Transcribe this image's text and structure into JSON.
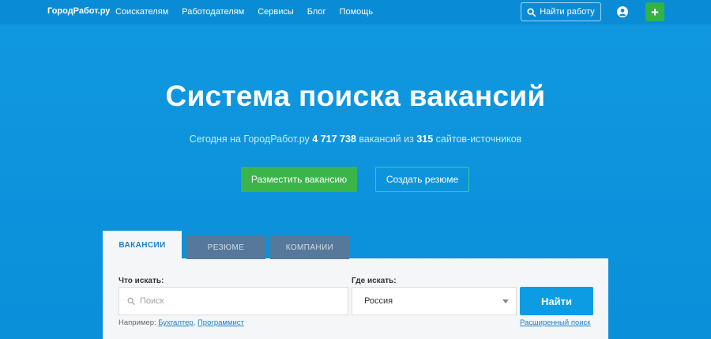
{
  "header": {
    "logo": "ГородРабот.ру",
    "nav": [
      "Соискателям",
      "Работодателям",
      "Сервисы",
      "Блог",
      "Помощь"
    ],
    "find_job_label": "Найти работу",
    "plus_label": "+"
  },
  "hero": {
    "title": "Система поиска вакансий",
    "sub_prefix": "Сегодня на ГородРабот.ру",
    "vacancy_count": "4 717 738",
    "sub_middle": "вакансий из",
    "source_count": "315",
    "sub_suffix": "сайтов-источников",
    "post_button": "Разместить вакансию",
    "resume_button": "Создать резюме"
  },
  "search": {
    "tabs": [
      "ВАКАНСИИ",
      "РЕЗЮМЕ",
      "КОМПАНИИ"
    ],
    "what_label": "Что искать:",
    "what_placeholder": "Поиск",
    "where_label": "Где искать:",
    "where_value": "Россия",
    "submit_label": "Найти",
    "example_prefix": "Например:",
    "example_1": "Бухгалтер",
    "example_sep": ",",
    "example_2": "Программист",
    "advanced_link": "Расширенный поиск"
  },
  "colors": {
    "background": "#0a8fd9",
    "accent_green": "#3bb54a",
    "link_blue": "#1d80c8",
    "submit_blue": "#0b9ce4"
  }
}
